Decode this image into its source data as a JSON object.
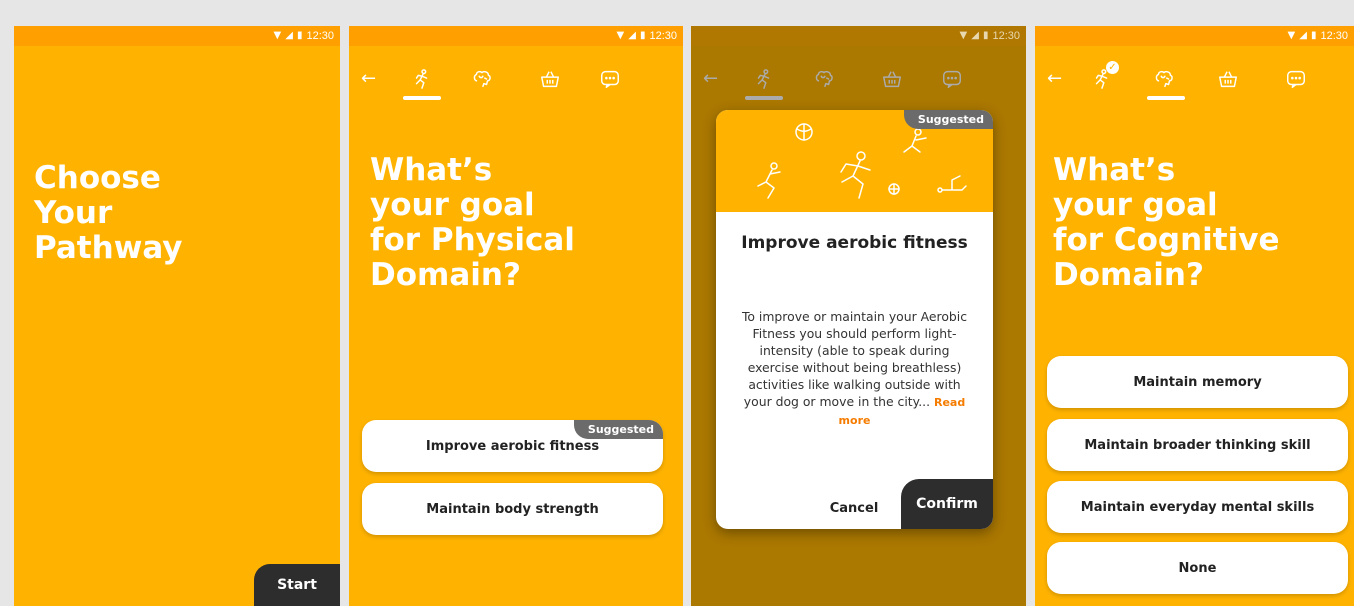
{
  "status_bar": {
    "time": "12:30",
    "icons": [
      "wifi-icon",
      "signal-icon",
      "battery-icon"
    ]
  },
  "nav": {
    "back_icon": "arrow-left-icon",
    "tabs": [
      "physical-runner-icon",
      "cognitive-brain-icon",
      "basket-icon",
      "chat-bubble-icon"
    ]
  },
  "colors": {
    "accent": "#FFB300",
    "status_bar": "#FFA000",
    "dark_button": "#2d2d2d",
    "badge": "#6b6b6b",
    "link": "#F57C00"
  },
  "screen1": {
    "title_line1": "Choose",
    "title_line2": "Your",
    "title_line3": "Pathway",
    "start_label": "Start"
  },
  "screen2": {
    "title_line1": "What’s",
    "title_line2": "your goal",
    "title_line3": "for Physical",
    "title_line4": "Domain?",
    "options": [
      {
        "label": "Improve aerobic fitness",
        "badge": "Suggested"
      },
      {
        "label": "Maintain body strength"
      }
    ]
  },
  "screen3": {
    "badge": "Suggested",
    "title": "Improve aerobic fitness",
    "description": "To improve or maintain your Aerobic Fitness you should perform light-intensity (able to speak during exercise without being breathless) activities like walking outside with your dog or move in the city...",
    "read_more": "Read more",
    "cancel_label": "Cancel",
    "confirm_label": "Confirm"
  },
  "screen4": {
    "title_line1": "What’s",
    "title_line2": "your goal",
    "title_line3": "for Cognitive",
    "title_line4": "Domain?",
    "options": [
      {
        "label": "Maintain memory"
      },
      {
        "label": "Maintain broader thinking skill"
      },
      {
        "label": "Maintain everyday mental skills"
      },
      {
        "label": "None"
      }
    ]
  }
}
